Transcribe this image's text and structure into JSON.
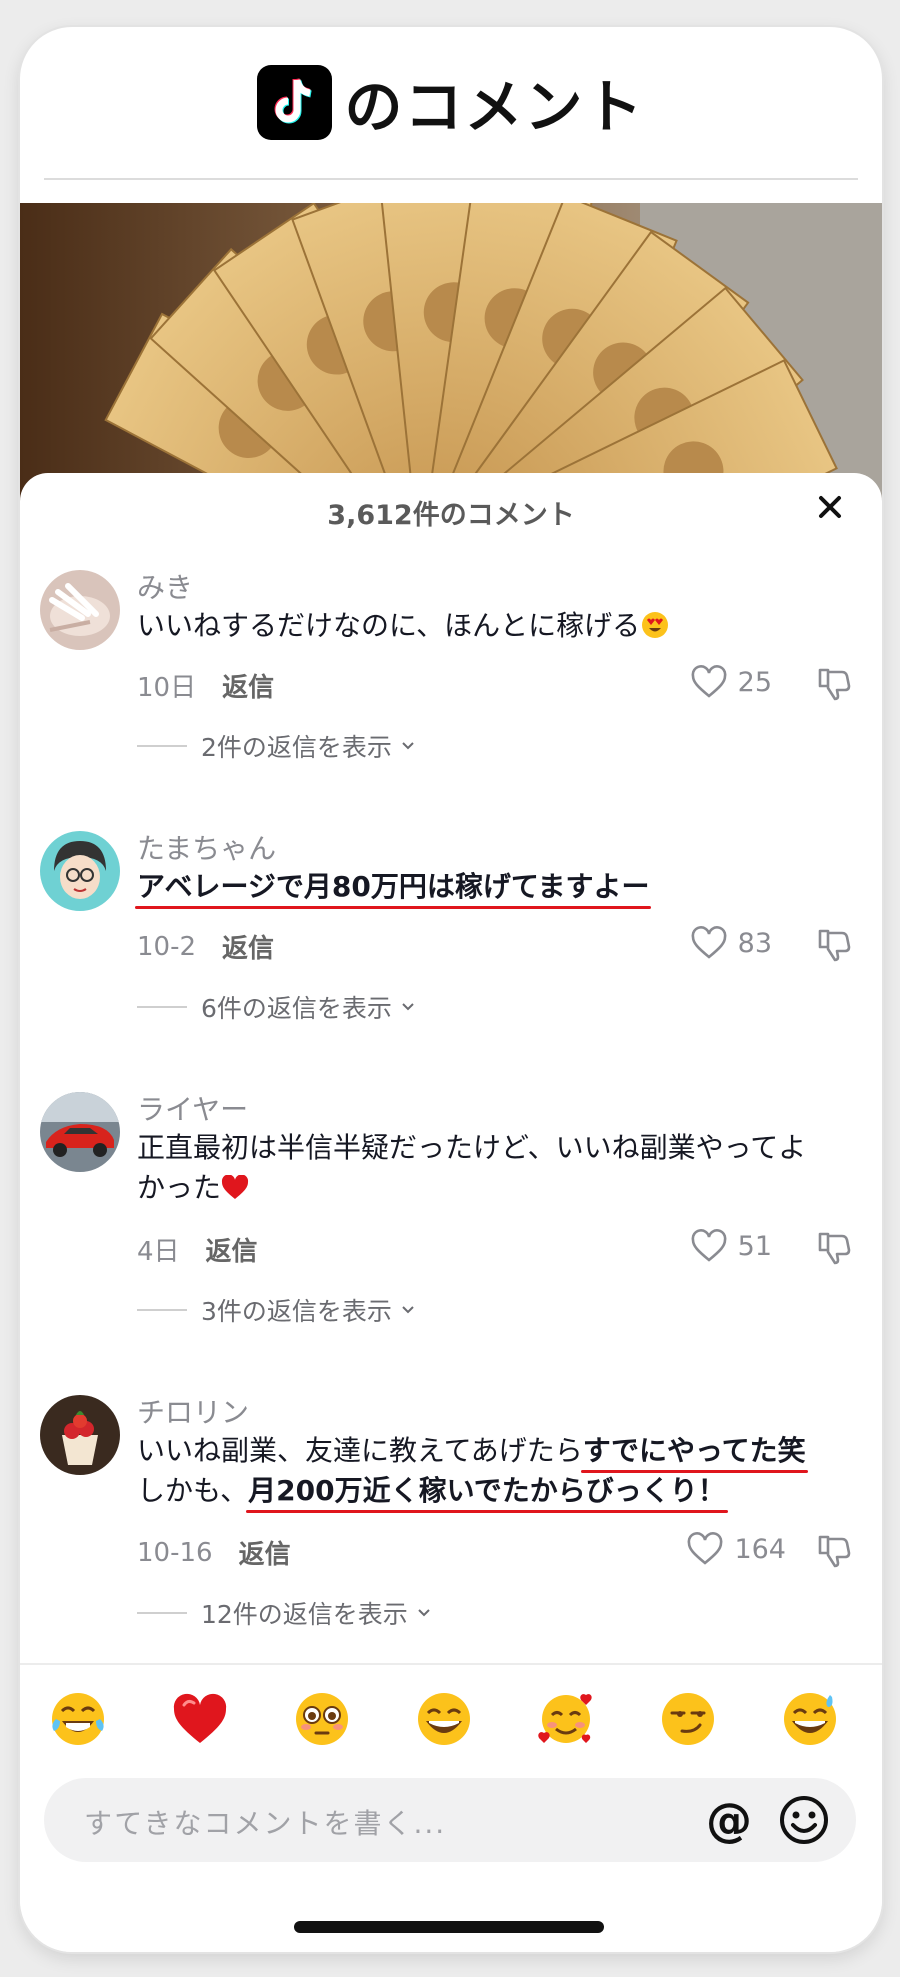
{
  "header": {
    "title": "のコメント",
    "logo": "tiktok-logo"
  },
  "sheet": {
    "count": "3,612件のコメント",
    "close_icon": "close-icon"
  },
  "comments": [
    {
      "user": "みき",
      "t1": "いいねするだけなのに、ほんとに稼げる",
      "emoji": "heart-eyes-emoji",
      "date": "10日",
      "reply": "返信",
      "likes": "25",
      "replies": "2件の返信を表示"
    },
    {
      "user": "たまちゃん",
      "u1": "アベレージで月80万円は稼げてますよー",
      "date": "10-2",
      "reply": "返信",
      "likes": "83",
      "replies": "6件の返信を表示"
    },
    {
      "user": "ライヤー",
      "t1": "正直最初は半信半疑だったけど、いいね副業やってよかった",
      "emoji": "red-heart-emoji",
      "date": "4日",
      "reply": "返信",
      "likes": "51",
      "replies": "3件の返信を表示"
    },
    {
      "user": "チロリン",
      "t1": "いいね副業、友達に教えてあげたら",
      "u1": "すでにやってた笑",
      "t2": "しかも、",
      "u2": "月200万近く稼いでたからびっくり！",
      "date": "10-16",
      "reply": "返信",
      "likes": "164",
      "replies": "12件の返信を表示"
    }
  ],
  "emoji_bar": [
    "tears-of-joy-emoji",
    "red-heart-emoji",
    "flushed-emoji",
    "grinning-emoji",
    "smiling-with-hearts-emoji",
    "smirk-emoji",
    "sweat-smile-emoji"
  ],
  "input": {
    "placeholder": "すてきなコメントを書く...",
    "at_label": "@",
    "emoji_icon": "smile-icon"
  },
  "colors": {
    "underline": "#e0161d",
    "text": "#161823",
    "meta": "#8a8b91"
  }
}
